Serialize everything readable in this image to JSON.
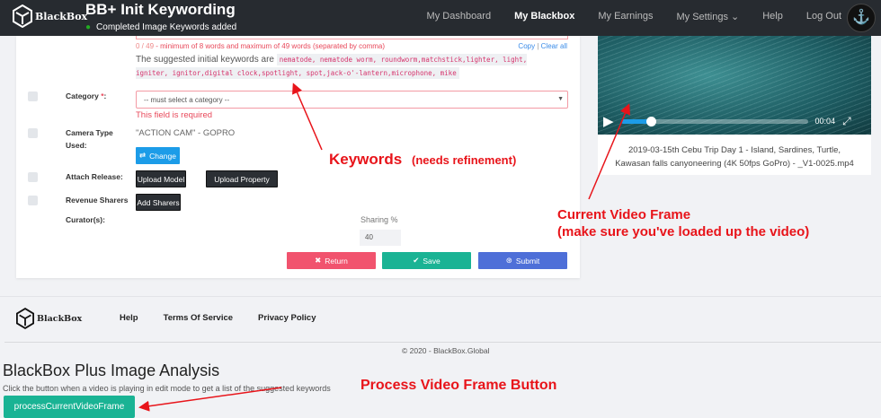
{
  "nav": {
    "logo": "BlackBox",
    "title": "BB+ Init Keywording",
    "status": "Completed Image Keywords added",
    "links": [
      "My Dashboard",
      "My Blackbox",
      "My Earnings",
      "My Settings",
      "Help",
      "Log Out"
    ],
    "active": "My Blackbox"
  },
  "form": {
    "keyword_count": "0 / 49",
    "keyword_hint": "- minimum of 8 words and maximum of 49 words (separated by comma)",
    "copy": "Copy",
    "sep": "|",
    "clear_all": "Clear all",
    "suggested_prefix": "The suggested initial keywords are",
    "suggested_keywords": "nematode, nematode worm, roundworm,matchstick,lighter, light, igniter, ignitor,digital clock,spotlight, spot,jack-o'-lantern,microphone, mike",
    "category_label": "Category",
    "required_mark": "*",
    "category_colon": ":",
    "category_placeholder": "-- must select a category --",
    "category_error": "This field is required",
    "camera_label": "Camera Type Used:",
    "camera_value": "\"ACTION CAM\" - GOPRO",
    "change": "Change",
    "release_label": "Attach Release:",
    "upload_model": "Upload Model",
    "upload_property": "Upload Property",
    "sharers_label": "Revenue Sharers",
    "add_sharers": "Add Sharers",
    "curators_label": "Curator(s):",
    "sharing_label": "Sharing %",
    "sharing_value": "40",
    "return": "Return",
    "save": "Save",
    "submit": "Submit"
  },
  "video": {
    "time": "00:04",
    "progress": 0.16,
    "caption": "2019-03-15th Cebu Trip Day 1 - Island, Sardines, Turtle, Kawasan falls canyoneering (4K 50fps GoPro) - _V1-0025.mp4"
  },
  "annotations": {
    "keywords": "Keywords",
    "keywords_note": "(needs refinement)",
    "frame1": "Current Video Frame",
    "frame2": "(make sure you've loaded up the video)",
    "process": "Process Video Frame Button"
  },
  "footer": {
    "logo": "BlackBox",
    "links": [
      "Help",
      "Terms Of Service",
      "Privacy Policy"
    ],
    "copyright": "© 2020 - BlackBox.Global"
  },
  "analysis": {
    "heading": "BlackBox Plus Image Analysis",
    "description": "Click the button when a video is playing in edit mode to get a list of the suggested keywords",
    "button": "processCurrentVideoFrame"
  },
  "colors": {
    "nav": "#272b30",
    "error": "#e8485a",
    "return": "#f1536e",
    "save": "#1ab394",
    "submit": "#4e6fd8",
    "change": "#1c9ce8",
    "annotation": "#e8141a"
  }
}
